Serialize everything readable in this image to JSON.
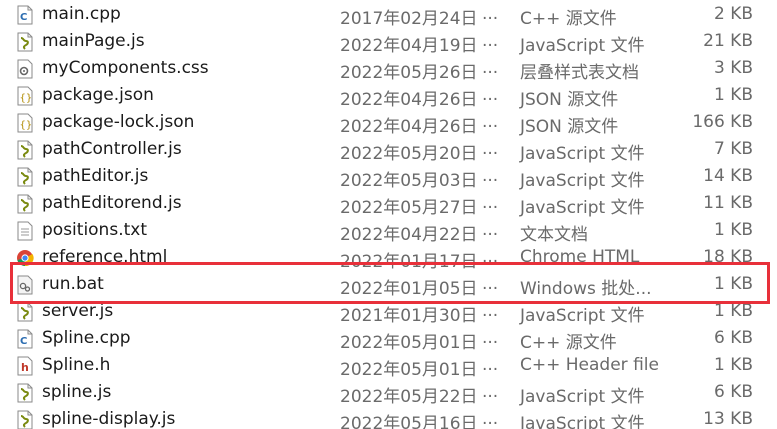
{
  "files": [
    {
      "name": "main.cpp",
      "date": "2017年02月24日",
      "ellipsis": "...",
      "type": "C++ 源文件",
      "size": "2 KB",
      "icon": "cpp-file-icon"
    },
    {
      "name": "mainPage.js",
      "date": "2022年04月19日",
      "ellipsis": "...",
      "type": "JavaScript 文件",
      "size": "21 KB",
      "icon": "js-file-icon"
    },
    {
      "name": "myComponents.css",
      "date": "2022年05月26日",
      "ellipsis": "...",
      "type": "层叠样式表文档",
      "size": "3 KB",
      "icon": "css-file-icon"
    },
    {
      "name": "package.json",
      "date": "2022年04月26日",
      "ellipsis": "...",
      "type": "JSON 源文件",
      "size": "1 KB",
      "icon": "json-file-icon"
    },
    {
      "name": "package-lock.json",
      "date": "2022年04月26日",
      "ellipsis": "...",
      "type": "JSON 源文件",
      "size": "166 KB",
      "icon": "json-file-icon"
    },
    {
      "name": "pathController.js",
      "date": "2022年05月20日",
      "ellipsis": "...",
      "type": "JavaScript 文件",
      "size": "7 KB",
      "icon": "js-file-icon"
    },
    {
      "name": "pathEditor.js",
      "date": "2022年05月03日",
      "ellipsis": "...",
      "type": "JavaScript 文件",
      "size": "14 KB",
      "icon": "js-file-icon"
    },
    {
      "name": "pathEditorend.js",
      "date": "2022年05月27日",
      "ellipsis": "...",
      "type": "JavaScript 文件",
      "size": "11 KB",
      "icon": "js-file-icon"
    },
    {
      "name": "positions.txt",
      "date": "2022年04月22日",
      "ellipsis": "...",
      "type": "文本文档",
      "size": "1 KB",
      "icon": "txt-file-icon"
    },
    {
      "name": "reference.html",
      "date": "2022年01月17日",
      "ellipsis": "...",
      "type": "Chrome HTML",
      "size": "18 KB",
      "icon": "chrome-html-icon"
    },
    {
      "name": "run.bat",
      "date": "2022年01月05日",
      "ellipsis": "...",
      "type": "Windows 批处...",
      "size": "1 KB",
      "icon": "bat-file-icon"
    },
    {
      "name": "server.js",
      "date": "2021年01月30日",
      "ellipsis": "...",
      "type": "JavaScript 文件",
      "size": "1 KB",
      "icon": "js-file-icon"
    },
    {
      "name": "Spline.cpp",
      "date": "2022年05月01日",
      "ellipsis": "...",
      "type": "C++ 源文件",
      "size": "6 KB",
      "icon": "cpp-file-icon"
    },
    {
      "name": "Spline.h",
      "date": "2022年05月01日",
      "ellipsis": "...",
      "type": "C++ Header file",
      "size": "1 KB",
      "icon": "header-file-icon"
    },
    {
      "name": "spline.js",
      "date": "2022年05月22日",
      "ellipsis": "...",
      "type": "JavaScript 文件",
      "size": "6 KB",
      "icon": "js-file-icon"
    },
    {
      "name": "spline-display.js",
      "date": "2022年05月16日",
      "ellipsis": "...",
      "type": "JavaScript 文件",
      "size": "13 KB",
      "icon": "js-file-icon"
    }
  ],
  "highlighted_file": "run.bat",
  "colors": {
    "highlight": "#e8303a",
    "secondary_text": "#6a6a6a",
    "primary_text": "#1a1a1a"
  }
}
